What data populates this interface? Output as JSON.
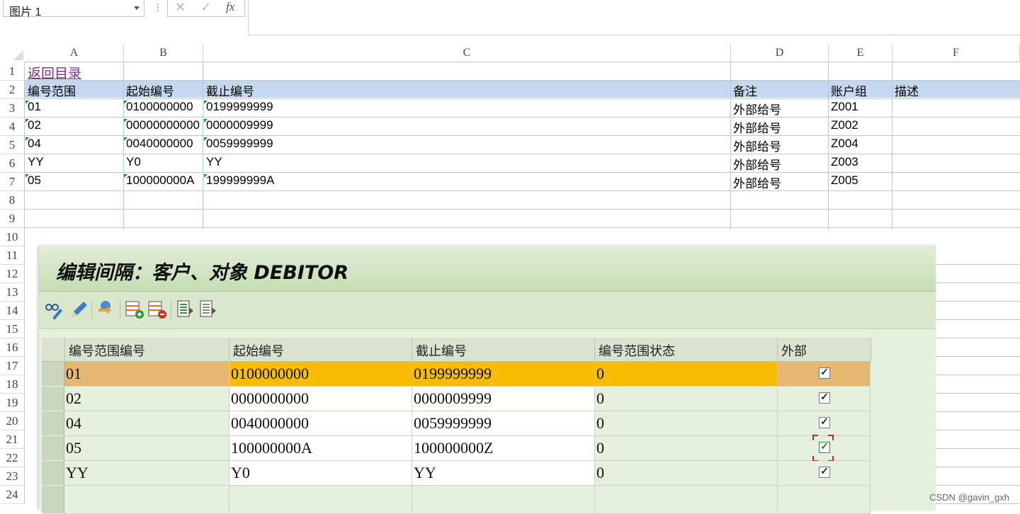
{
  "formula_bar": {
    "name_box": "图片 1",
    "cancel_icon": "✕",
    "enter_icon": "✓",
    "fx_label": "fx"
  },
  "columns": [
    "A",
    "B",
    "C",
    "D",
    "E",
    "F"
  ],
  "rows": [
    "1",
    "2",
    "3",
    "4",
    "5",
    "6",
    "7",
    "8",
    "9",
    "10",
    "11",
    "12",
    "13",
    "14",
    "15",
    "16",
    "17",
    "18",
    "19",
    "20",
    "21",
    "22",
    "23",
    "24"
  ],
  "sheet": {
    "link": "返回目录",
    "header": [
      "编号范围",
      "起始编号",
      "截止编号",
      "备注",
      "账户组",
      "描述"
    ],
    "data": [
      [
        "01",
        "0100000000",
        "0199999999",
        "外部给号",
        "Z001",
        ""
      ],
      [
        "02",
        "00000000000",
        "0000009999",
        "外部给号",
        "Z002",
        ""
      ],
      [
        "04",
        "0040000000",
        "0059999999",
        "外部给号",
        "Z004",
        ""
      ],
      [
        "YY",
        "Y0",
        "YY",
        "外部给号",
        "Z003",
        ""
      ],
      [
        "05",
        "100000000A",
        "199999999A",
        "外部给号",
        "Z005",
        ""
      ]
    ],
    "header_band_color": "#c4d8ef"
  },
  "sap_dialog": {
    "title": "编辑间隔：客户、对象 DEBITOR",
    "toolbar_icons": [
      "glasses-pencil-icon",
      "pencil-icon",
      "transport-icon",
      "insert-line-icon",
      "delete-line-icon",
      "select-all-icon",
      "deselect-all-icon"
    ],
    "columns": [
      "编号范围编号",
      "起始编号",
      "截止编号",
      "编号范围状态",
      "外部"
    ],
    "rows": [
      {
        "no": "01",
        "from": "0100000000",
        "to": "0199999999",
        "status": "0",
        "external": true,
        "selected": true
      },
      {
        "no": "02",
        "from": "0000000000",
        "to": "0000009999",
        "status": "0",
        "external": true,
        "selected": false
      },
      {
        "no": "04",
        "from": "0040000000",
        "to": "0059999999",
        "status": "0",
        "external": true,
        "selected": false
      },
      {
        "no": "05",
        "from": "100000000A",
        "to": "100000000Z",
        "status": "0",
        "external": true,
        "selected": false,
        "focused": true
      },
      {
        "no": "YY",
        "from": "Y0",
        "to": "YY",
        "status": "0",
        "external": true,
        "selected": false
      }
    ],
    "check_mark": "✓",
    "colors": {
      "selected_row": "#f8bc00",
      "selected_row_tail": "#e6b770",
      "title_bg": "#c6ddb2",
      "toolbar_bg": "#d9e8cc"
    }
  },
  "watermark": "CSDN @gavin_gxh"
}
